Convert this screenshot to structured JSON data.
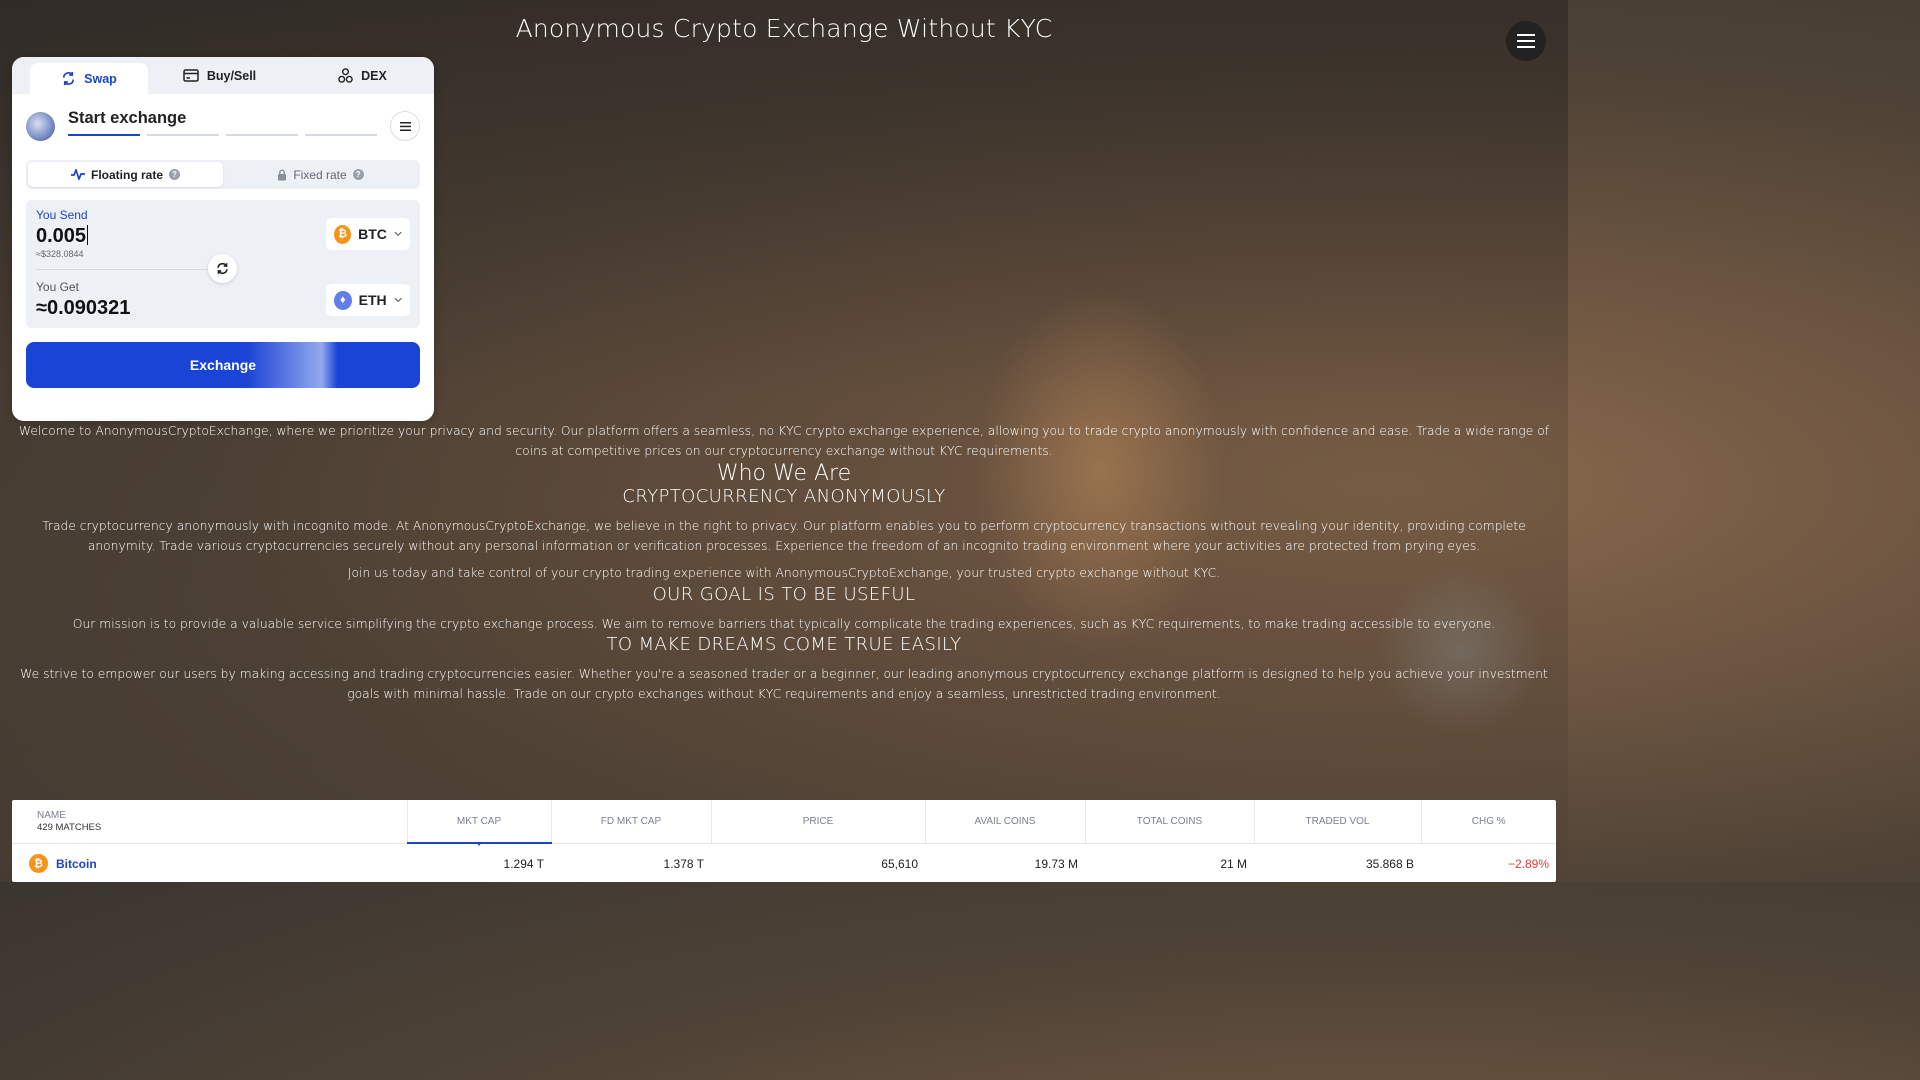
{
  "page": {
    "title": "Anonymous Crypto Exchange Without KYC"
  },
  "widget": {
    "tabs": [
      {
        "label": "Swap",
        "icon": "swap-icon"
      },
      {
        "label": "Buy/Sell",
        "icon": "card-icon"
      },
      {
        "label": "DEX",
        "icon": "dex-icon"
      }
    ],
    "step_title": "Start exchange",
    "rate": {
      "floating": "Floating rate",
      "fixed": "Fixed rate",
      "selected": "Floating rate"
    },
    "send": {
      "label": "You Send",
      "amount": "0.005",
      "usd": "≈$328.0844",
      "coin": "BTC"
    },
    "get": {
      "label": "You Get",
      "amount": "≈0.090321",
      "coin": "ETH"
    },
    "exchange_button": "Exchange"
  },
  "content": {
    "intro": "Welcome to AnonymousCryptoExchange, where we prioritize your privacy and security. Our platform offers a seamless, no KYC crypto exchange experience, allowing you to trade crypto anonymously with confidence and ease. Trade a wide range of coins at competitive prices on our cryptocurrency exchange without KYC requirements.",
    "who_heading": "Who We Are",
    "crypto_heading": "CRYPTOCURRENCY ANONYMOUSLY",
    "crypto_text": "Trade cryptocurrency anonymously with incognito mode. At AnonymousCryptoExchange, we believe in the right to privacy. Our platform enables you to perform cryptocurrency transactions without revealing your identity, providing complete anonymity. Trade various cryptocurrencies securely without any personal information or verification processes. Experience the freedom of an incognito trading environment where your activities are protected from prying eyes.",
    "join_text": "Join us today and take control of your crypto trading experience with AnonymousCryptoExchange, your trusted crypto exchange without KYC.",
    "goal_heading": "OUR GOAL IS TO BE USEFUL",
    "goal_text": "Our mission is to provide a valuable service simplifying the crypto exchange process. We aim to remove barriers that typically complicate the trading experiences, such as KYC requirements, to make trading accessible to everyone.",
    "dreams_heading": "TO MAKE DREAMS COME TRUE EASILY",
    "dreams_text": "We strive to empower our users by making accessing and trading cryptocurrencies easier. Whether you're a seasoned trader or a beginner, our leading anonymous cryptocurrency exchange platform is designed to help you achieve your investment goals with minimal hassle. Trade on our crypto exchanges without KYC requirements and enjoy a seamless, unrestricted trading environment."
  },
  "market": {
    "name_header": "NAME",
    "matches": "429 MATCHES",
    "columns": [
      "MKT CAP",
      "FD MKT CAP",
      "PRICE",
      "AVAIL COINS",
      "TOTAL COINS",
      "TRADED VOL",
      "CHG %"
    ],
    "active_column": "MKT CAP",
    "rows": [
      {
        "name": "Bitcoin",
        "icon": "btc-coin-icon",
        "mkt_cap": "1.294 T",
        "fd_mkt_cap": "1.378 T",
        "price": "65,610",
        "avail_coins": "19.73 M",
        "total_coins": "21 M",
        "traded_vol": "35.868 B",
        "chg": "−2.89%"
      }
    ]
  },
  "colors": {
    "accent": "#1c44c9",
    "negative": "#e23b3b",
    "btc": "#f7931a",
    "eth": "#627eea"
  }
}
